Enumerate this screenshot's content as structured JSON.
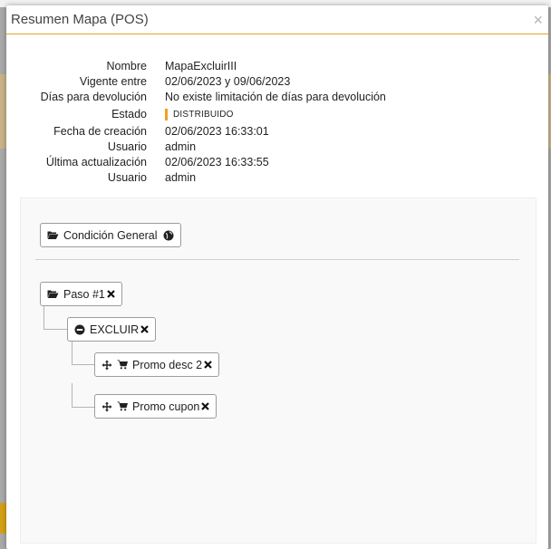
{
  "modal": {
    "title": "Resumen Mapa (POS)",
    "close_label": "×"
  },
  "details": [
    {
      "label": "Nombre",
      "value": "MapaExcluirIII"
    },
    {
      "label": "Vigente entre",
      "value": "02/06/2023 y 09/06/2023"
    },
    {
      "label": "Días para devolución",
      "value": "No existe limitación de días para devolución"
    },
    {
      "label": "Estado",
      "value": "DISTRIBUIDO"
    },
    {
      "label": "Fecha de creación",
      "value": "02/06/2023 16:33:01"
    },
    {
      "label": "Usuario",
      "value": "admin"
    },
    {
      "label": "Última actualización",
      "value": "02/06/2023 16:33:55"
    },
    {
      "label": "Usuario",
      "value": "admin"
    }
  ],
  "status_color": "#f0a020",
  "tree": {
    "general_condition": {
      "label": "Condición General",
      "icons": [
        "folder-open-icon",
        "globe-icon"
      ]
    },
    "step": {
      "label": "Paso #1",
      "icons": [
        "folder-open-icon",
        "close-icon"
      ]
    },
    "exclude": {
      "label": "EXCLUIR",
      "icons": [
        "minus-circle-icon",
        "close-icon"
      ]
    },
    "promos": [
      {
        "label": "Promo desc 2",
        "icons": [
          "move-icon",
          "cart-icon",
          "close-icon"
        ]
      },
      {
        "label": "Promo cupon",
        "icons": [
          "move-icon",
          "cart-icon",
          "close-icon"
        ]
      }
    ]
  }
}
